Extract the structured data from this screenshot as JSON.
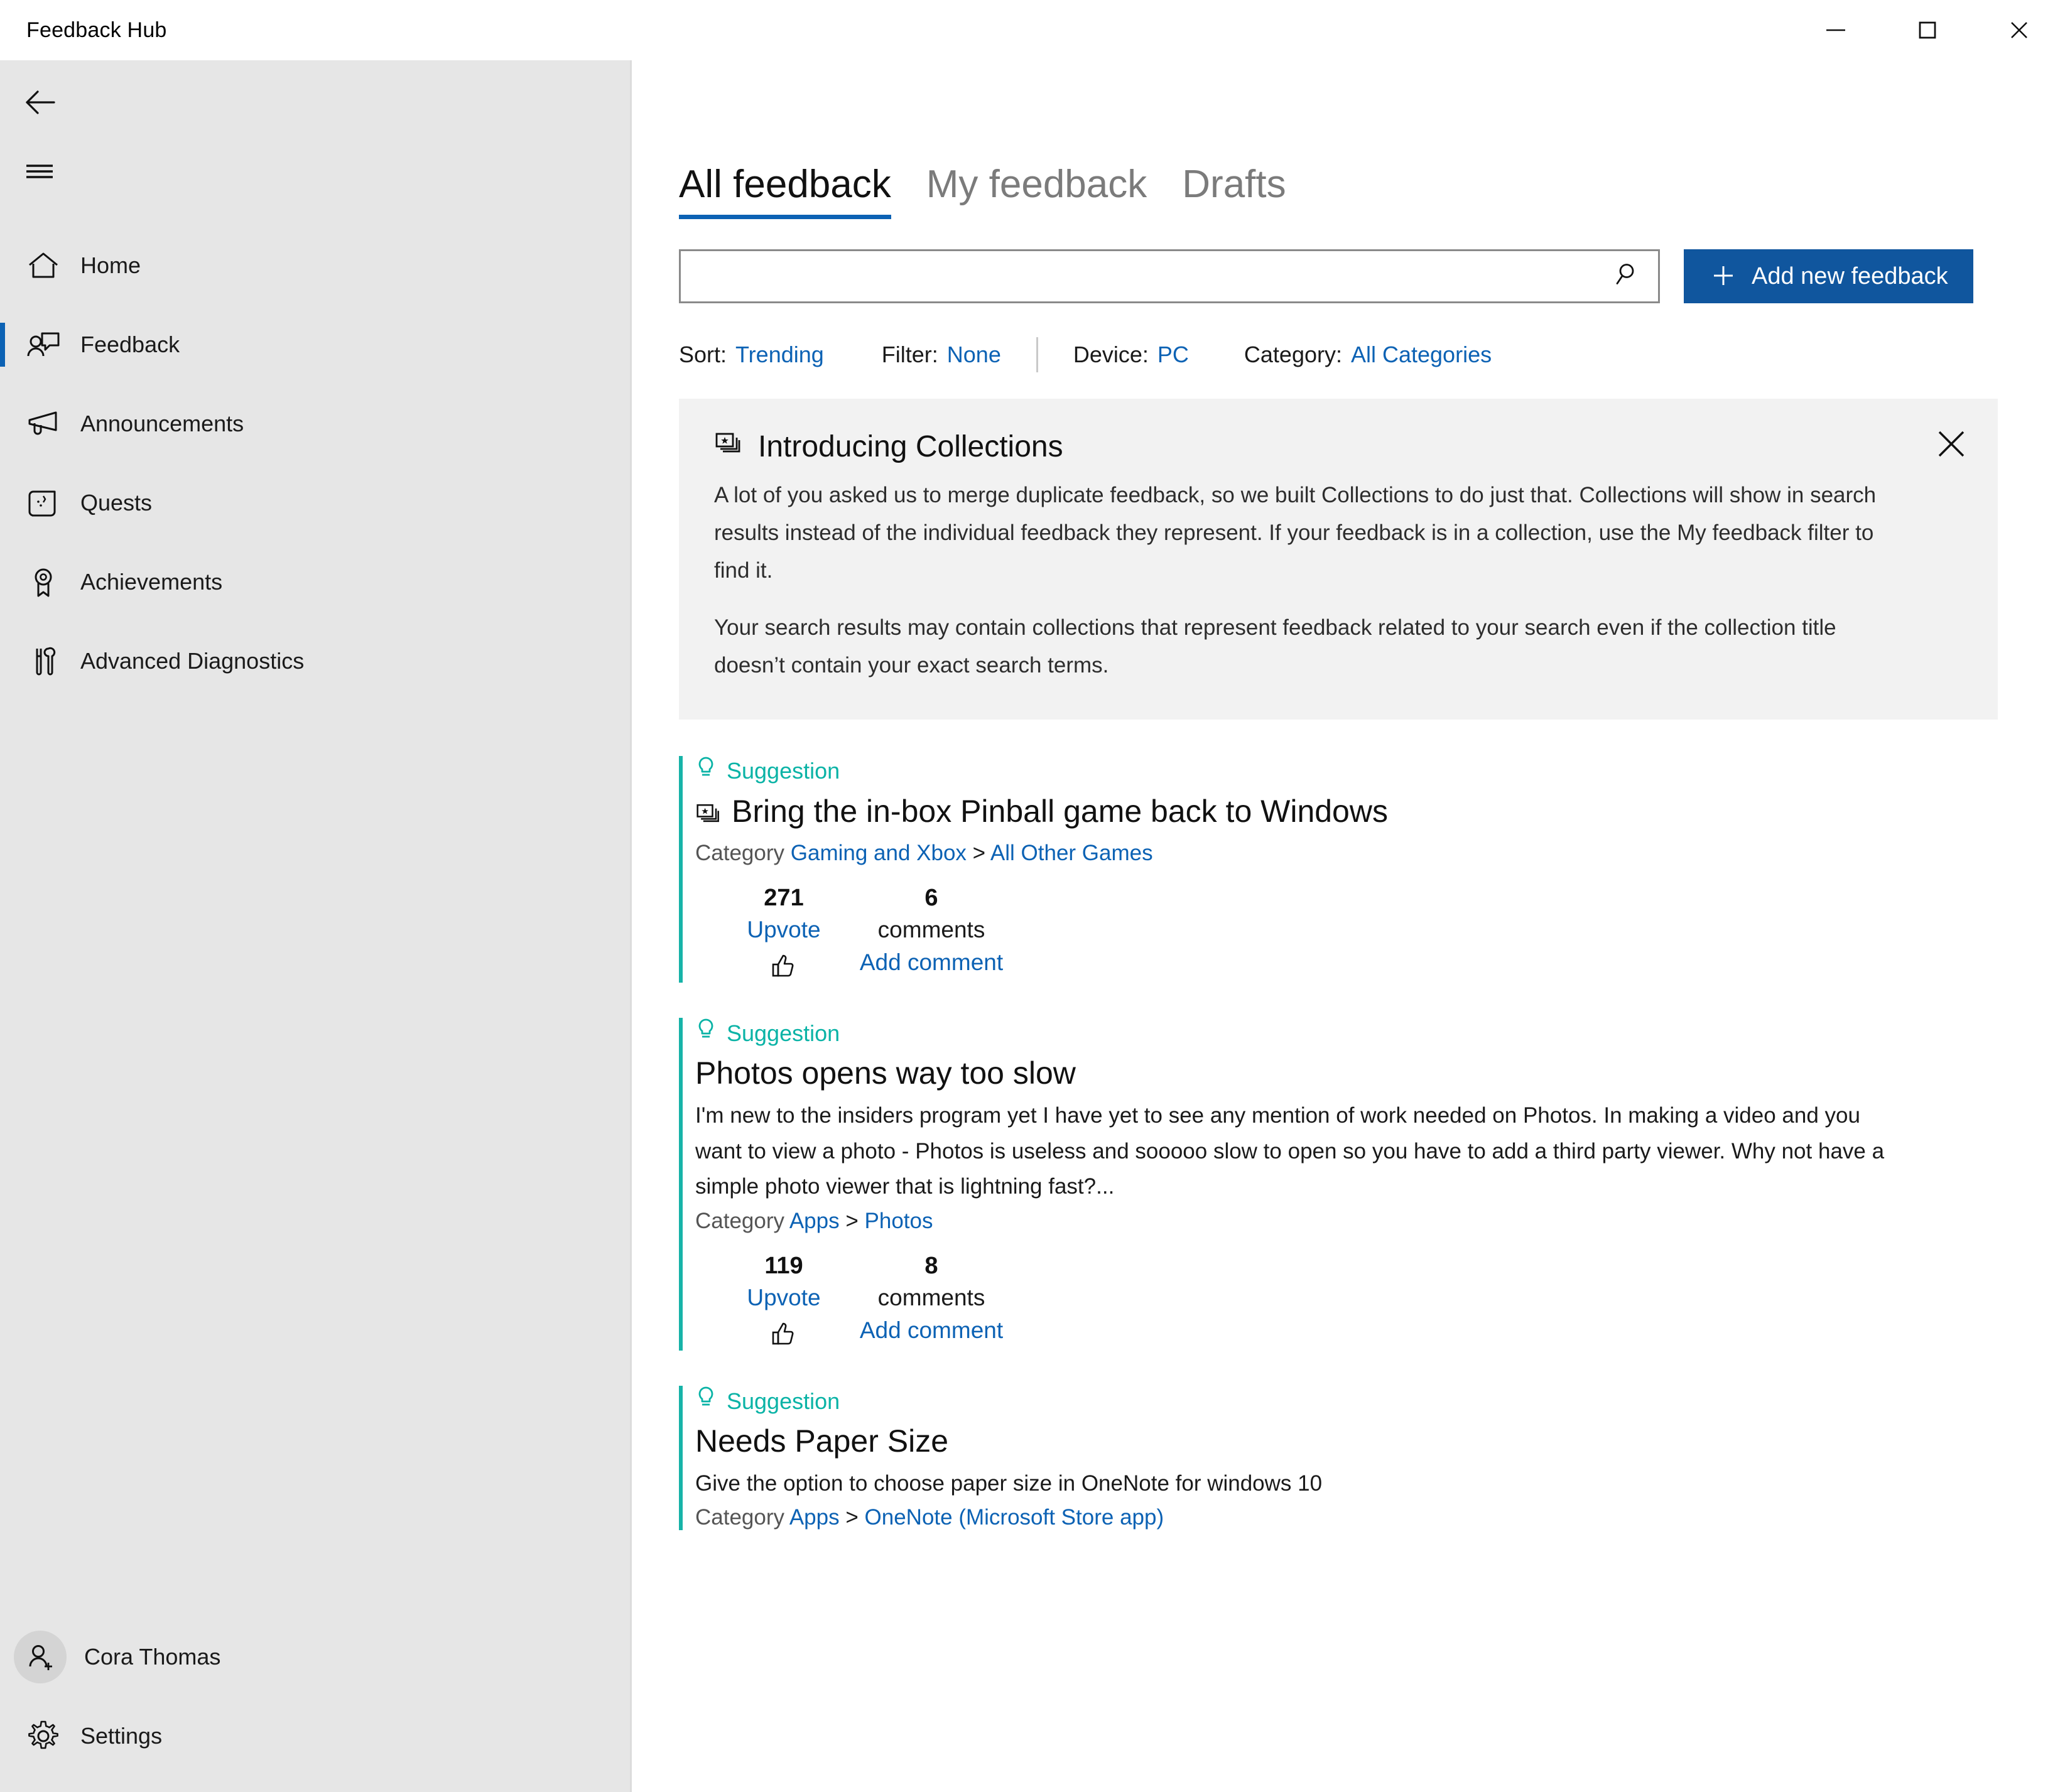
{
  "window": {
    "title": "Feedback Hub",
    "controls": [
      {
        "name": "minimize",
        "label": "–"
      },
      {
        "name": "maximize",
        "label": "□"
      },
      {
        "name": "close",
        "label": "✕"
      }
    ]
  },
  "colors": {
    "accent_blue": "#0c62b4",
    "button_blue": "#10569e",
    "suggestion_teal": "#0ab3a6",
    "sidebar_bg": "#e6e6e6",
    "banner_bg": "#f2f2f2"
  },
  "sidebar": {
    "back_icon": "back-arrow-icon",
    "menu_icon": "hamburger-menu-icon",
    "items": [
      {
        "label": "Home",
        "icon": "home-icon",
        "selected": false
      },
      {
        "label": "Feedback",
        "icon": "feedback-icon",
        "selected": true
      },
      {
        "label": "Announcements",
        "icon": "megaphone-icon",
        "selected": false
      },
      {
        "label": "Quests",
        "icon": "scroll-icon",
        "selected": false
      },
      {
        "label": "Achievements",
        "icon": "ribbon-icon",
        "selected": false
      },
      {
        "label": "Advanced Diagnostics",
        "icon": "tools-icon",
        "selected": false
      }
    ],
    "account": {
      "label": "Cora Thomas",
      "icon": "person-add-icon"
    },
    "settings": {
      "label": "Settings",
      "icon": "gear-icon"
    }
  },
  "main": {
    "tabs": [
      {
        "label": "All feedback",
        "active": true
      },
      {
        "label": "My feedback",
        "active": false
      },
      {
        "label": "Drafts",
        "active": false
      }
    ],
    "search": {
      "value": "",
      "placeholder": "",
      "icon": "search-icon"
    },
    "add_button": {
      "label": "Add new feedback",
      "icon": "plus-icon"
    },
    "filters": [
      {
        "key": "Sort:",
        "value": "Trending"
      },
      {
        "key": "Filter:",
        "value": "None"
      },
      {
        "key": "Device:",
        "value": "PC"
      },
      {
        "key": "Category:",
        "value": "All Categories"
      }
    ],
    "banner": {
      "icon": "collections-icon",
      "title": "Introducing Collections",
      "close_icon": "close-icon",
      "paragraphs": [
        "A lot of you asked us to merge duplicate feedback, so we built Collections to do just that. Collections will show in search results instead of the individual feedback they represent. If your feedback is in a collection, use the My feedback filter to find it.",
        "Your search results may contain collections that represent feedback related to your search even if the collection title doesn’t contain your exact search terms."
      ]
    },
    "feedback_items": [
      {
        "type": "Suggestion",
        "type_icon": "lightbulb-icon",
        "collection_icon": "collections-icon",
        "has_collection_icon": true,
        "title": "Bring the in-box Pinball game back to Windows",
        "description": "",
        "category_label": "Category",
        "category_path": [
          "Gaming and Xbox",
          "All Other Games"
        ],
        "category_separator": ">",
        "upvotes": "271",
        "upvote_label": "Upvote",
        "upvote_icon": "thumbs-up-icon",
        "comment_count": "6",
        "comment_label": "comments",
        "add_comment_label": "Add comment"
      },
      {
        "type": "Suggestion",
        "type_icon": "lightbulb-icon",
        "has_collection_icon": false,
        "title": "Photos opens way too slow",
        "description": "I'm new to the insiders program yet I have yet to see any mention of work needed on Photos.  In making a video and you want to view a photo - Photos is useless and sooooo slow to open so you have to add a third party viewer.  Why not have a simple photo viewer that is lightning fast?...",
        "category_label": "Category",
        "category_path": [
          "Apps",
          "Photos"
        ],
        "category_separator": ">",
        "upvotes": "119",
        "upvote_label": "Upvote",
        "upvote_icon": "thumbs-up-icon",
        "comment_count": "8",
        "comment_label": "comments",
        "add_comment_label": "Add comment"
      },
      {
        "type": "Suggestion",
        "type_icon": "lightbulb-icon",
        "has_collection_icon": false,
        "title": "Needs Paper Size",
        "description": "Give the option to choose paper size in OneNote for windows 10",
        "category_label": "Category",
        "category_path": [
          "Apps",
          "OneNote (Microsoft Store app)"
        ],
        "category_separator": ">",
        "upvotes": "",
        "upvote_label": "",
        "comment_count": "",
        "comment_label": "",
        "add_comment_label": ""
      }
    ]
  }
}
